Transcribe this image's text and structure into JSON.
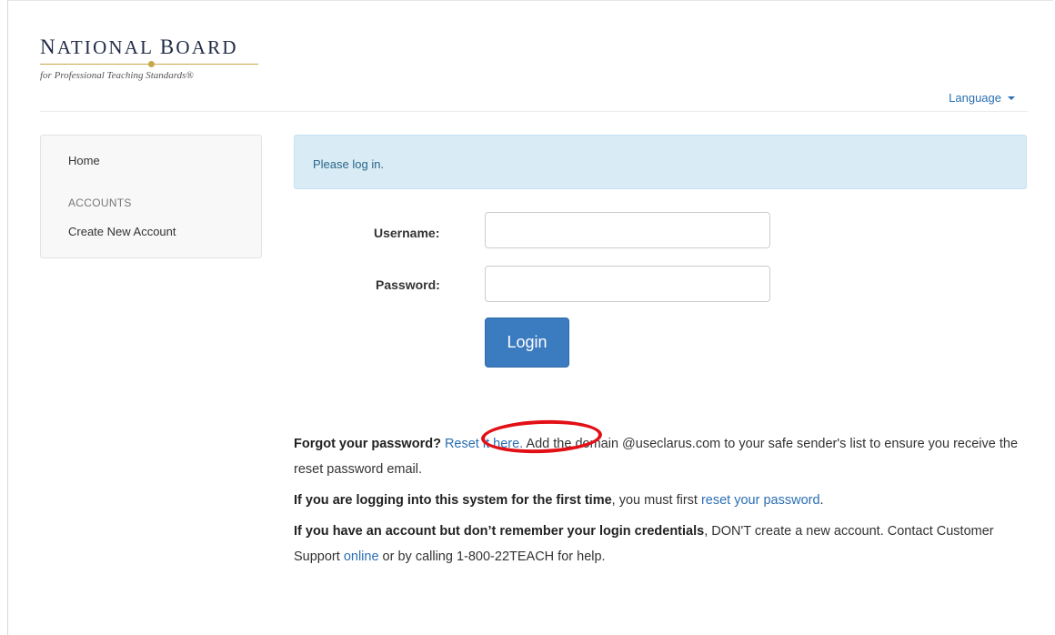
{
  "header": {
    "logo": {
      "title_parts": [
        "N",
        "ATIONAL ",
        "B",
        "OARD"
      ],
      "subtitle": "for Professional Teaching Standards®"
    },
    "language_label": "Language",
    "language_icon": "caret-down-icon"
  },
  "sidebar": {
    "home": "Home",
    "section_heading": "ACCOUNTS",
    "create_account": "Create New Account"
  },
  "alert": {
    "text": "Please log in."
  },
  "form": {
    "username_label": "Username:",
    "username_value": "",
    "password_label": "Password:",
    "password_value": "",
    "login_button": "Login"
  },
  "notes": {
    "forgot": {
      "bold": "Forgot your password?",
      "link": "Reset it here.",
      "text": " Add the domain @useclarus.com to your safe sender's list to ensure you receive the reset password email."
    },
    "first_time": {
      "bold": "If you are logging into this system for the first time",
      "text": ", you must first ",
      "link": "reset your password",
      "end": "."
    },
    "no_remember": {
      "bold": "If you have an account but don’t remember your login credentials",
      "text1": ", DON'T create a new account. Contact Customer Support ",
      "link": "online",
      "text2": " or by calling 1-800-22TEACH for help."
    }
  },
  "colors": {
    "link": "#2a6fb4",
    "button": "#3b7bc0",
    "alert_bg": "#d9ecf6",
    "highlight_circle": "#e30f16",
    "logo_gold": "#c9a64a"
  }
}
